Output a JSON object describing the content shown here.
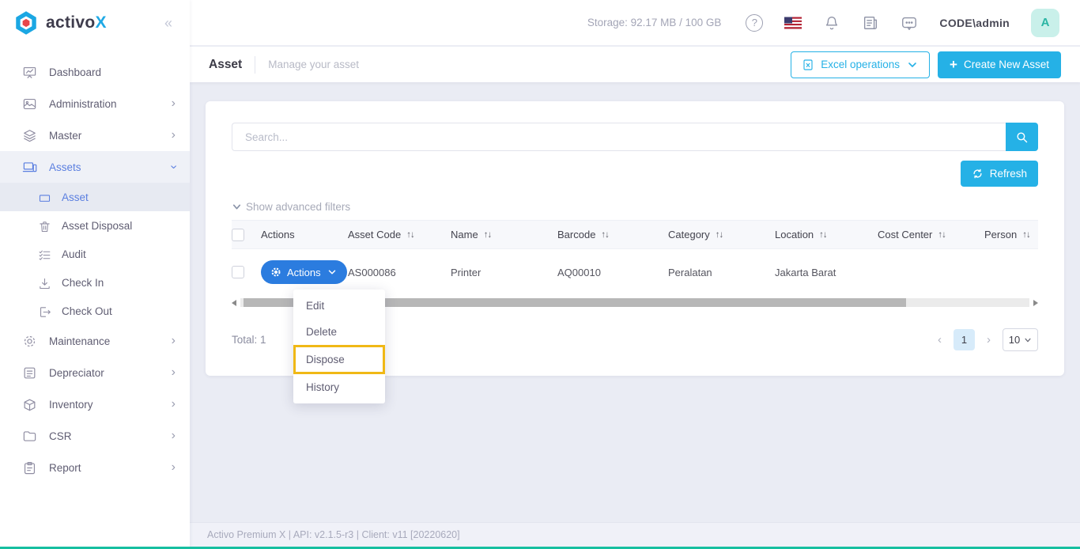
{
  "colors": {
    "cyan": "#25b1e6",
    "action_blue": "#2b7cdf",
    "highlight_yellow": "#f0b816",
    "active_blue": "#5b7fe0",
    "avatar_teal_bg": "#c9f0ea"
  },
  "icons": {
    "sort": "↑↓",
    "collapse": "«",
    "chevron_right": "›",
    "prev": "‹",
    "next": "›",
    "help": "?",
    "plus": "+"
  },
  "brand": {
    "logo": "activo",
    "logo_accent": "X"
  },
  "topbar": {
    "storage": "Storage: 92.17 MB / 100 GB",
    "username": "CODE\\admin",
    "avatar_initial": "A"
  },
  "pagebar": {
    "title": "Asset",
    "subtitle": "Manage your asset",
    "excel_button": "Excel operations",
    "create_button": "Create New Asset"
  },
  "card": {
    "search_placeholder": "Search...",
    "refresh_button": "Refresh",
    "filters_toggle": "Show advanced filters",
    "total": "Total: 1"
  },
  "table": {
    "headers": {
      "actions": "Actions",
      "asset_code": "Asset Code",
      "name": "Name",
      "barcode": "Barcode",
      "category": "Category",
      "location": "Location",
      "cost_center": "Cost Center",
      "person": "Person"
    },
    "row": {
      "actions_button": "Actions",
      "asset_code": "AS000086",
      "name": "Printer",
      "barcode": "AQ00010",
      "category": "Peralatan",
      "location": "Jakarta Barat",
      "cost_center": "",
      "person": ""
    }
  },
  "dropdown": {
    "edit": "Edit",
    "delete": "Delete",
    "dispose": "Dispose",
    "history": "History"
  },
  "pagination": {
    "current_page": "1",
    "page_size": "10"
  },
  "sidebar": {
    "items": [
      {
        "label": "Dashboard"
      },
      {
        "label": "Administration"
      },
      {
        "label": "Master"
      },
      {
        "label": "Assets"
      },
      {
        "label": "Asset"
      },
      {
        "label": "Asset Disposal"
      },
      {
        "label": "Audit"
      },
      {
        "label": "Check In"
      },
      {
        "label": "Check Out"
      },
      {
        "label": "Maintenance"
      },
      {
        "label": "Depreciator"
      },
      {
        "label": "Inventory"
      },
      {
        "label": "CSR"
      },
      {
        "label": "Report"
      }
    ]
  },
  "footer": {
    "text": "Activo Premium X | API: v2.1.5-r3 | Client: v11 [20220620]"
  }
}
